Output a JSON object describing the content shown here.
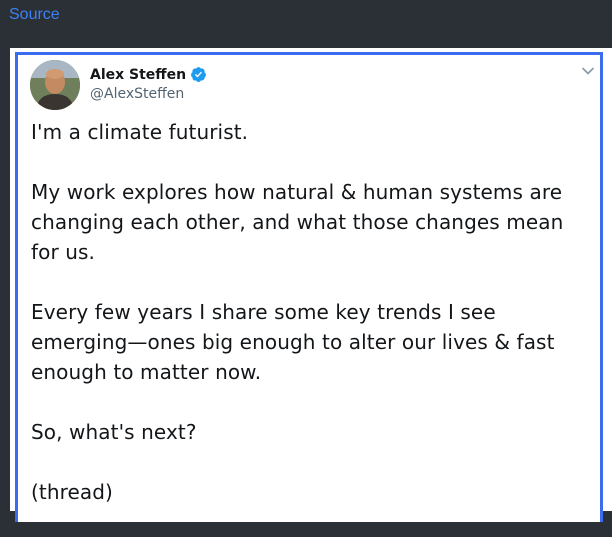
{
  "topbar": {
    "source_label": "Source"
  },
  "tweet": {
    "author_name": "Alex Steffen",
    "author_handle": "@AlexSteffen",
    "verified": true,
    "paragraphs": [
      "I'm a climate futurist.",
      "My work explores how natural & human systems are changing each other, and what those changes mean for us.",
      "Every few years I share some key trends I see emerging—ones big enough to alter our lives & fast enough to matter now.",
      "So, what's next?",
      "(thread)"
    ]
  },
  "colors": {
    "background": "#2b3036",
    "link": "#3b82f6",
    "frame_border": "#3b6cf0",
    "verified_badge": "#1d9bf0",
    "text": "#14171a",
    "handle": "#536471"
  },
  "icons": {
    "verified": "verified-badge-icon",
    "menu": "chevron-down-icon"
  }
}
